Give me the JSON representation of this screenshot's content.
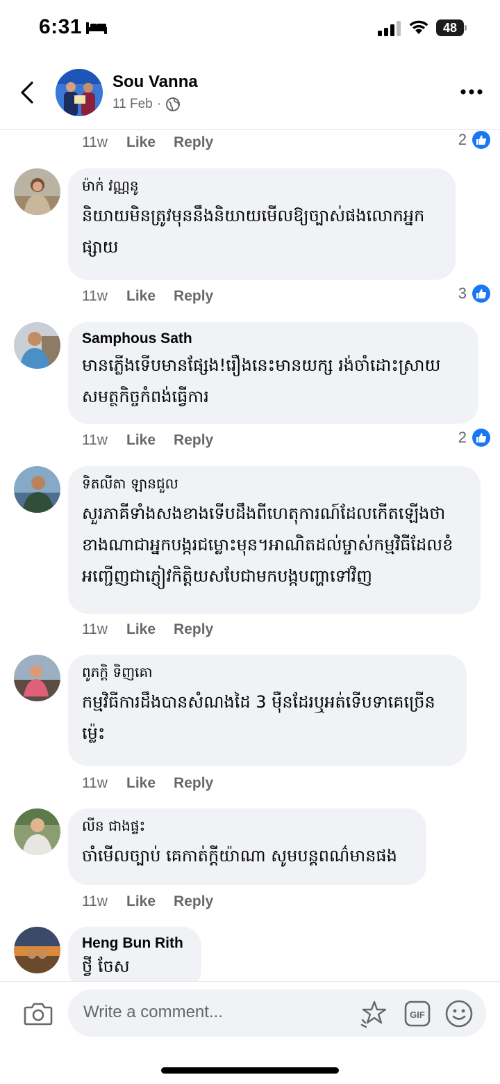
{
  "status_bar": {
    "time": "6:31",
    "battery": "48"
  },
  "post_header": {
    "author": "Sou Vanna",
    "date": "11 Feb",
    "separator": "·"
  },
  "top_actions": {
    "time": "11w",
    "like": "Like",
    "reply": "Reply",
    "reactions": "2"
  },
  "comments": [
    {
      "name": "ម៉ាក់ វណ្ណនូ",
      "text": "និយាយមិនត្រូវមុននឹងនិយាយមើលឱ្យច្បាស់ផងលោកអ្នកផ្សាយ",
      "time": "11w",
      "like": "Like",
      "reply": "Reply",
      "reactions": "3"
    },
    {
      "name": "Samphous Sath",
      "text": "មានភ្លើងទើបមានផ្សែង!រឿងនេះមានយក្ស រង់ចាំដោះស្រាយសមត្ថកិច្ចកំពង់ធ្វើការ",
      "time": "11w",
      "like": "Like",
      "reply": "Reply",
      "reactions": "2"
    },
    {
      "name": "ទិតលីតា ឡានជួល",
      "text": "សួរភាគីទាំងសងខាងទើបដឹងពីហេតុការណ៍ដែលកើតឡើងថាខាងណាជាអ្នកបង្ករជម្លោះមុន។អាណិតដល់ម្ចាស់កម្មវិធីដែលខំអញ្ជើញជាភ្ញៀវកិត្តិយសបែជាមកបង្កបញ្ហាទៅវិញ",
      "time": "11w",
      "like": "Like",
      "reply": "Reply",
      "reactions": ""
    },
    {
      "name": "ពូភក្តិ ទិញគោ",
      "text": "កម្មវិធីការដឹងបានសំណងដៃ 3 ម៉ឺនដែរឬអត់ទើបទាគេច្រើនម្ល៉េះ",
      "time": "11w",
      "like": "Like",
      "reply": "Reply",
      "reactions": ""
    },
    {
      "name": "លីន ជាងផ្ទះ",
      "text": "ចាំមើលច្បាប់ គេកាត់ក្តីយ៉ាណា សូមបន្តពណ៌មានផង",
      "time": "11w",
      "like": "Like",
      "reply": "Reply",
      "reactions": ""
    },
    {
      "name": "Heng Bun Rith",
      "text": "ថ្វី ចែស",
      "time": "",
      "like": "",
      "reply": "",
      "reactions": ""
    }
  ],
  "composer": {
    "placeholder": "Write a comment..."
  },
  "colors": {
    "accent": "#1877f2",
    "bubble": "#f0f2f5",
    "meta": "#65676b"
  }
}
